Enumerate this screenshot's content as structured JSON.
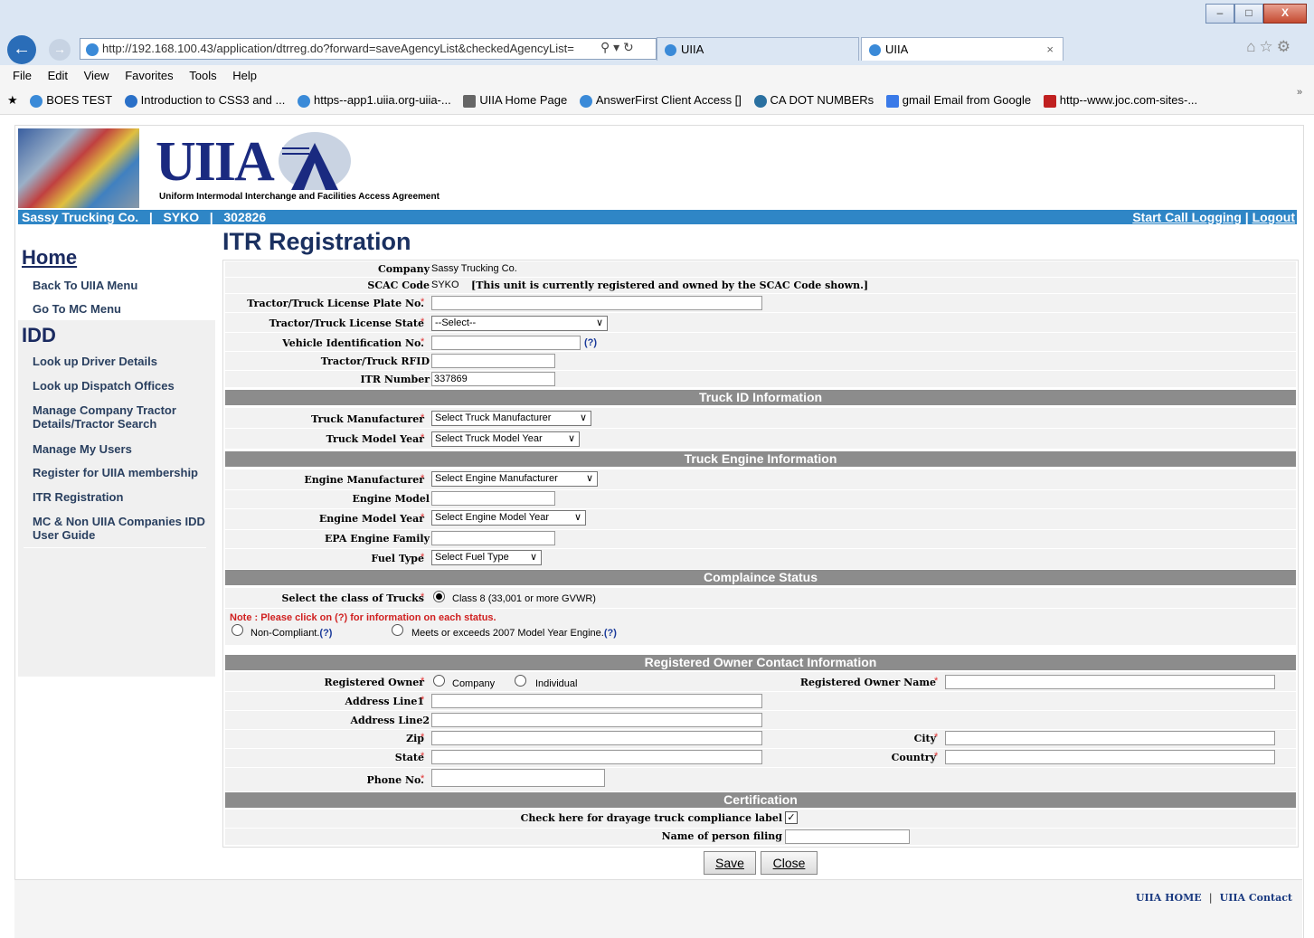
{
  "browser": {
    "url": "http://192.168.100.43/application/dtrreg.do?forward=saveAgencyList&checkedAgencyList=",
    "tabs": [
      {
        "label": "UIIA"
      },
      {
        "label": "UIIA"
      }
    ],
    "tab_close": "×",
    "menu": [
      "File",
      "Edit",
      "View",
      "Favorites",
      "Tools",
      "Help"
    ],
    "favorites": [
      "BOES TEST",
      "Introduction to CSS3 and ...",
      "https--app1.uiia.org-uiia-...",
      "UIIA Home Page",
      "AnswerFirst Client Access []",
      "CA DOT NUMBERs",
      "gmail Email from Google",
      "http--www.joc.com-sites-..."
    ],
    "fav_more": "»",
    "window_buttons": {
      "minimize": "–",
      "maximize": "□",
      "close": "X"
    }
  },
  "header": {
    "logo": "UIIA",
    "tagline": "Uniform Intermodal Interchange and Facilities Access  Agreement",
    "company": "Sassy Trucking Co.",
    "scac": "SYKO",
    "id": "302826",
    "start_call": "Start Call Logging",
    "logout": "Logout",
    "sep": "|"
  },
  "sidebar": {
    "home_heading": "Home",
    "home_items": [
      "Back To UIIA Menu",
      "Go To MC Menu"
    ],
    "idd_heading": "IDD",
    "idd_items": [
      "Look up Driver Details",
      "Look up Dispatch Offices",
      "Manage Company Tractor Details/Tractor Search",
      "Manage My Users",
      "Register for UIIA membership",
      "ITR Registration",
      "MC & Non UIIA Companies IDD User Guide"
    ]
  },
  "page_title": "ITR Registration",
  "form": {
    "company_label": "Company",
    "company_value": "Sassy Trucking Co.",
    "scac_label": "SCAC Code",
    "scac_value": "SYKO",
    "scac_note": "[This unit is currently registered and owned by the SCAC Code shown.]",
    "plate_label": "Tractor/Truck License Plate No.",
    "state_label": "Tractor/Truck License State",
    "state_value": "--Select--",
    "vin_label": "Vehicle Identification No.",
    "help": "(?)",
    "rfid_label": "Tractor/Truck RFID",
    "itr_label": "ITR Number",
    "itr_value": "337869",
    "sec_truck_id": "Truck ID Information",
    "mfr_label": "Truck Manufacturer",
    "mfr_value": "Select Truck Manufacturer",
    "model_year_label": "Truck Model Year",
    "model_year_value": "Select Truck Model Year",
    "sec_engine": "Truck Engine Information",
    "eng_mfr_label": "Engine Manufacturer",
    "eng_mfr_value": "Select Engine Manufacturer",
    "eng_model_label": "Engine Model",
    "eng_year_label": "Engine Model Year",
    "eng_year_value": "Select Engine Model Year",
    "epa_label": "EPA Engine Family",
    "fuel_label": "Fuel Type",
    "fuel_value": "Select Fuel Type",
    "sec_compliance": "Complaince Status",
    "class_label": "Select the class of Trucks",
    "class_value": "Class 8 (33,001 or more GVWR)",
    "note": "Note : Please click on (?) for information on each status.",
    "noncompliant": "Non-Compliant.",
    "meets": "Meets or exceeds 2007 Model Year Engine.",
    "sec_owner": "Registered Owner Contact Information",
    "owner_label": "Registered Owner",
    "owner_company": "Company",
    "owner_individual": "Individual",
    "owner_name_label": "Registered Owner Name",
    "addr1_label": "Address Line1",
    "addr2_label": "Address Line2",
    "zip_label": "Zip",
    "city_label": "City",
    "st_label": "State",
    "country_label": "Country",
    "phone_label": "Phone No.",
    "sec_cert": "Certification",
    "drayage_label": "Check here for drayage truck compliance label",
    "filer_label": "Name of person filing",
    "save": "Save",
    "close": "Close",
    "req": "*"
  },
  "footer": {
    "home": "UIIA HOME",
    "contact": "UIIA Contact",
    "sep": "|"
  },
  "colors": {
    "strip_blue": "#2f86c6",
    "section_gray": "#8c8c8c",
    "required_red": "#e03030"
  }
}
